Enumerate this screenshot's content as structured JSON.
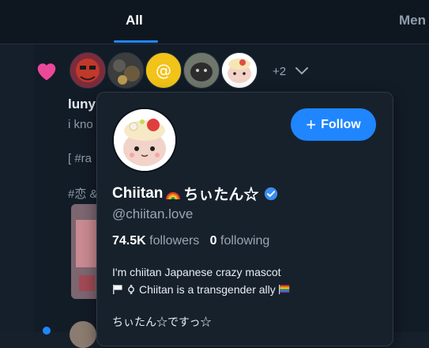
{
  "tabs": {
    "all": "All",
    "men": "Men"
  },
  "reactions": {
    "more": "+2"
  },
  "post": {
    "name": "luny",
    "line1": "i kno",
    "line2": "[ #ra",
    "line3": "#恋 &"
  },
  "profile": {
    "display_name": "Chiitan",
    "display_name_suffix": "ちぃたん☆",
    "handle": "@chiitan.love",
    "followers_count": "74.5K",
    "followers_label": "followers",
    "following_count": "0",
    "following_label": "following",
    "bio_line1": "I'm chiitan Japanese crazy mascot",
    "bio_line2": "Chiitan is a transgender ally",
    "bio_line3": "ちぃたん☆ですっ☆"
  },
  "follow_button": {
    "label": "Follow"
  },
  "colors": {
    "accent": "#1f86ff",
    "heart": "#ec4899",
    "verified": "#3b8df0"
  }
}
